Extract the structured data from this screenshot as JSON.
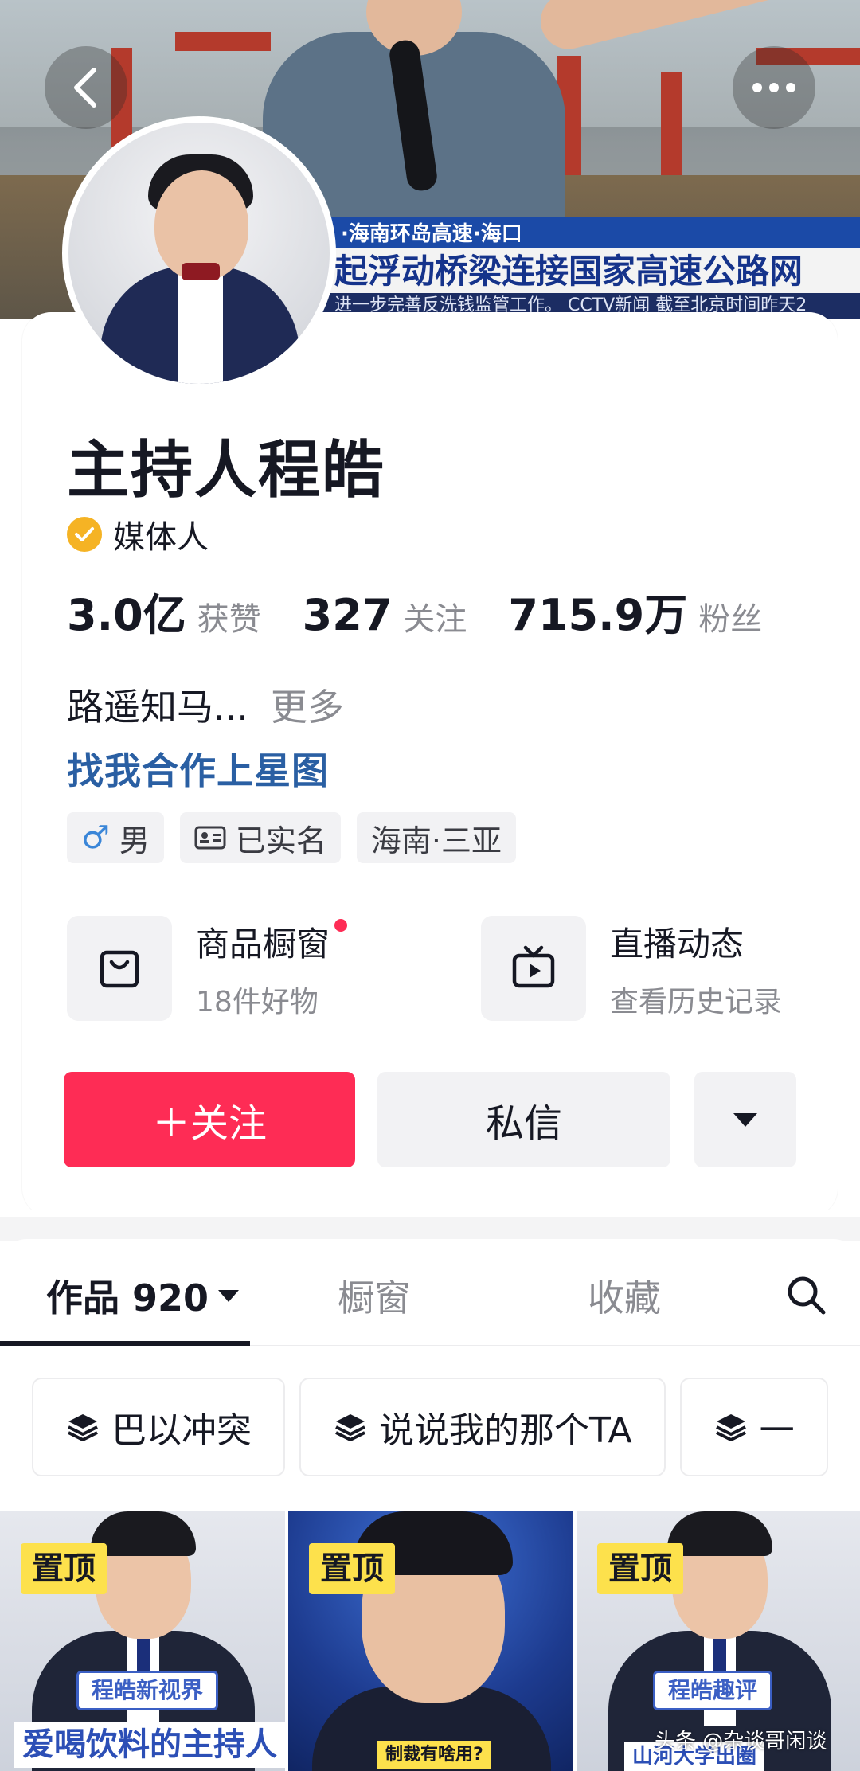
{
  "banner": {
    "news_location": "·海南环岛高速·海口",
    "news_headline": "起浮动桥梁连接国家高速公路网",
    "news_ticker": "进一步完善反洗钱监管工作。 CCTV新闻 截至北京时间昨天2"
  },
  "profile": {
    "name": "主持人程皓",
    "verify_label": "媒体人",
    "stats": [
      {
        "value": "3.0亿",
        "label": "获赞"
      },
      {
        "value": "327",
        "label": "关注"
      },
      {
        "value": "715.9万",
        "label": "粉丝"
      }
    ],
    "bio": "路遥知马...",
    "bio_more": "更多",
    "collab_link": "找我合作上星图",
    "tags": {
      "gender_icon": "♂",
      "gender": "男",
      "verified": "已实名",
      "location": "海南·三亚"
    }
  },
  "features": [
    {
      "title": "商品橱窗",
      "subtitle": "18件好物",
      "icon": "shopping-bag-icon",
      "badge": true
    },
    {
      "title": "直播动态",
      "subtitle": "查看历史记录",
      "icon": "live-tv-icon",
      "badge": false
    }
  ],
  "actions": {
    "follow": "＋关注",
    "message": "私信"
  },
  "tabs": {
    "works": "作品 920",
    "showcase": "橱窗",
    "favorites": "收藏"
  },
  "collections": [
    {
      "label": "巴以冲突"
    },
    {
      "label": "说说我的那个TA"
    },
    {
      "label": "一"
    }
  ],
  "videos": [
    {
      "pin": "置顶",
      "badge": "程皓新视界",
      "caption": "爱喝饮料的主持人"
    },
    {
      "pin": "置顶",
      "caption": "制裁有啥用?"
    },
    {
      "pin": "置顶",
      "badge": "程皓趣评",
      "caption": "山河大学出圈"
    }
  ],
  "watermark": "头条 @杂谈哥闲谈",
  "colors": {
    "accent": "#fe2c55",
    "link": "#2a5fa3",
    "verify": "#f5b324",
    "pin": "#fde14c"
  }
}
